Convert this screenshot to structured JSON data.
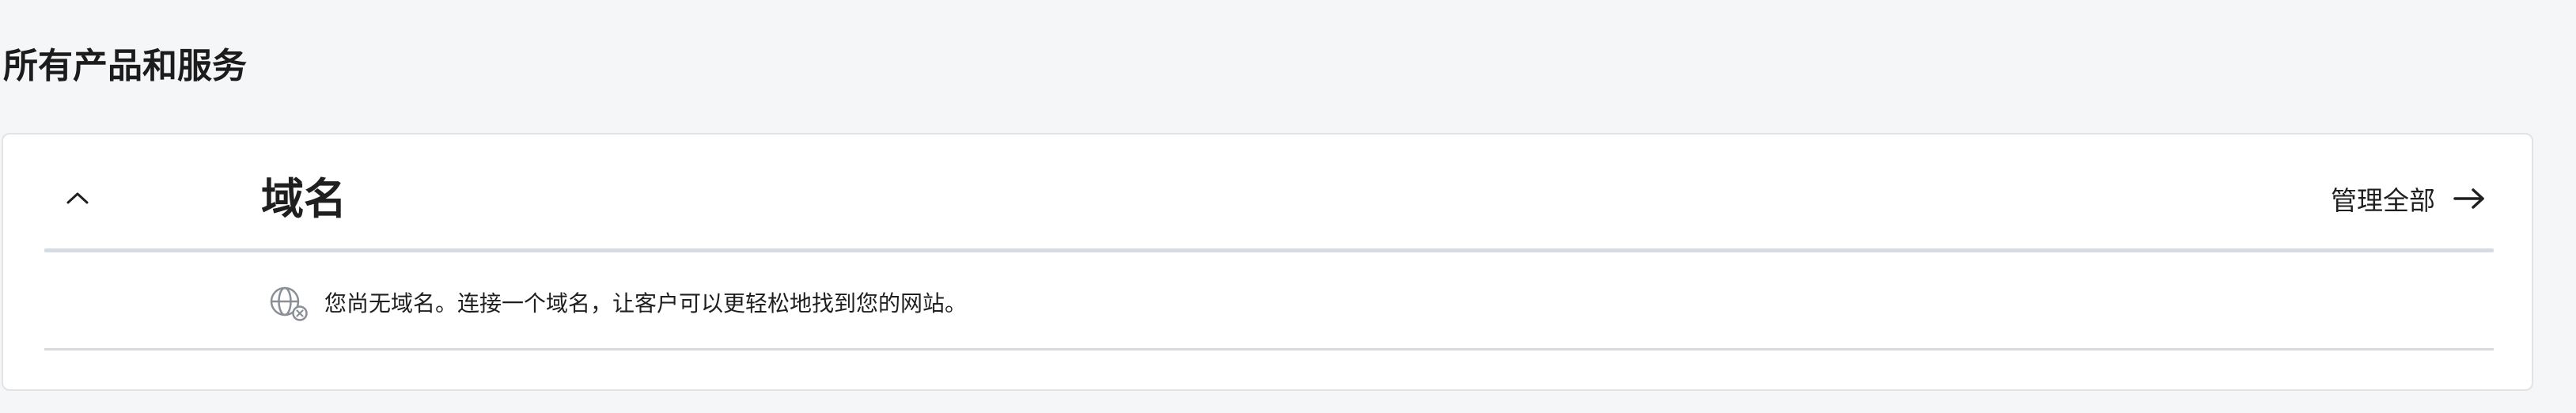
{
  "page": {
    "section_title": "所有产品和服务"
  },
  "domains_card": {
    "title": "域名",
    "manage_all_label": "管理全部",
    "empty_message": "您尚无域名。连接一个域名，让客户可以更轻松地找到您的网站。",
    "collapse_icon": "chevron-up-icon",
    "manage_icon": "arrow-right-icon",
    "empty_icon": "globe-with-x-icon"
  },
  "colors": {
    "page_background": "#f5f6f8",
    "card_background": "#ffffff",
    "divider": "#d6dce3",
    "text": "#1f1f1f"
  }
}
